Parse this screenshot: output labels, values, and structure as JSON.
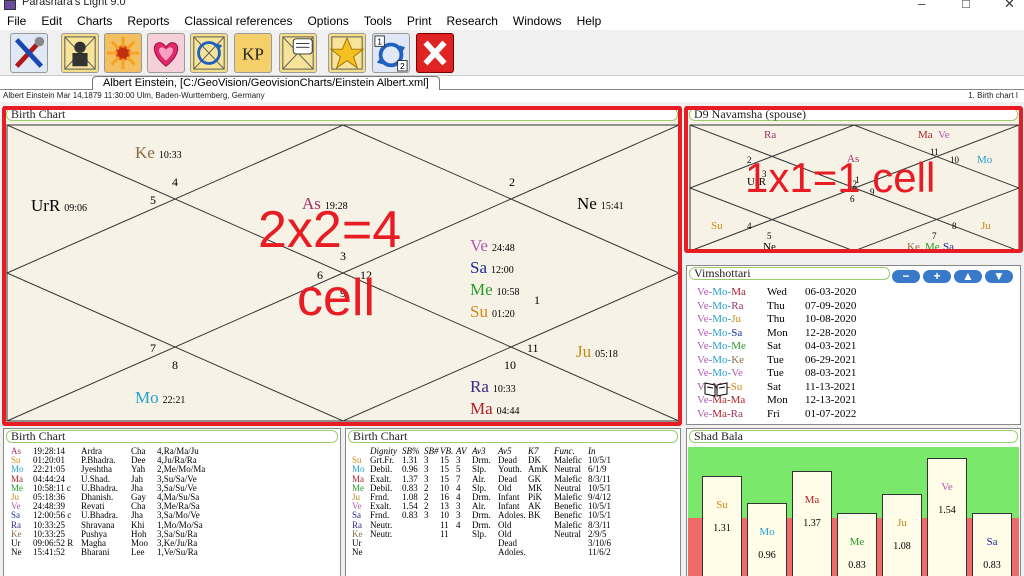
{
  "window": {
    "title": "Parashara's Light 9.0",
    "controls": [
      "–",
      "□",
      "✕"
    ]
  },
  "menu": [
    "File",
    "Edit",
    "Charts",
    "Reports",
    "Classical references",
    "Options",
    "Tools",
    "Print",
    "Research",
    "Windows",
    "Help"
  ],
  "toolbar": [
    {
      "name": "tools-icon"
    },
    {
      "name": "person-chart-icon"
    },
    {
      "name": "sun-burst-icon"
    },
    {
      "name": "hearts-icon"
    },
    {
      "name": "cycle-chart-icon"
    },
    {
      "name": "kp-icon",
      "label": "KP"
    },
    {
      "name": "notes-chart-icon"
    },
    {
      "name": "star-icon"
    },
    {
      "name": "transit-cycle-icon",
      "badges": [
        "1",
        "2"
      ]
    },
    {
      "name": "close-icon"
    }
  ],
  "tab": {
    "label": "Albert Einstein,  [C:/GeoVision/GeovisionCharts/Einstein Albert.xml]"
  },
  "status": {
    "left": "Albert Einstein  Mar 14,1879 11:30:00  Ulm, Baden-Wurttemberg, Germany",
    "right": "1. Birth chart I"
  },
  "birth_chart": {
    "title": "Birth Chart",
    "annotation_line1": "2x2=4",
    "annotation_line2": "cell",
    "house_numbers": [
      "1",
      "2",
      "3",
      "4",
      "5",
      "6",
      "7",
      "8",
      "9",
      "10",
      "11",
      "12"
    ],
    "planets": [
      {
        "name": "Ke",
        "deg": "10:33",
        "color": "#8b6b4a"
      },
      {
        "name": "UrR",
        "deg": "09:06",
        "color": "#000000"
      },
      {
        "name": "As",
        "deg": "19:28",
        "color": "#a0306a"
      },
      {
        "name": "Ne",
        "deg": "15:41",
        "color": "#000000"
      },
      {
        "name": "Ve",
        "deg": "24:48",
        "color": "#b05ab0"
      },
      {
        "name": "Sa",
        "deg": "12:00",
        "color": "#1b2a9a"
      },
      {
        "name": "Me",
        "deg": "10:58",
        "color": "#2a9a2a"
      },
      {
        "name": "Su",
        "deg": "01:20",
        "color": "#d08a1a"
      },
      {
        "name": "Ju",
        "deg": "05:18",
        "color": "#c08a1a"
      },
      {
        "name": "Mo",
        "deg": "22:21",
        "color": "#26a0d0"
      },
      {
        "name": "Ra",
        "deg": "10:33",
        "color": "#3a2a8a"
      },
      {
        "name": "Ma",
        "deg": "04:44",
        "color": "#b0202a"
      }
    ]
  },
  "navamsha": {
    "title": "D9 Navamsha  (spouse)",
    "annotation": "1x1=1 cell",
    "house_numbers": [
      "2",
      "3",
      "4",
      "5",
      "6",
      "7",
      "8",
      "9",
      "10",
      "11",
      "12",
      "1"
    ],
    "planets": [
      "Ra",
      "Ma",
      "Ve",
      "As",
      "Mo",
      "UrR",
      "Su",
      "Ju",
      "Ne",
      "Ke",
      "Me",
      "Sa"
    ]
  },
  "vimshottari": {
    "title": "Vimshottari",
    "buttons": [
      "−",
      "+",
      "▲",
      "▼"
    ],
    "rows": [
      {
        "p": "Ve-Mo-Ma",
        "d": "Wed",
        "t": "06-03-2020"
      },
      {
        "p": "Ve-Mo-Ra",
        "d": "Thu",
        "t": "07-09-2020"
      },
      {
        "p": "Ve-Mo-Ju",
        "d": "Thu",
        "t": "10-08-2020"
      },
      {
        "p": "Ve-Mo-Sa",
        "d": "Mon",
        "t": "12-28-2020"
      },
      {
        "p": "Ve-Mo-Me",
        "d": "Sat",
        "t": "04-03-2021"
      },
      {
        "p": "Ve-Mo-Ke",
        "d": "Tue",
        "t": "06-29-2021"
      },
      {
        "p": "Ve-Mo-Ve",
        "d": "Tue",
        "t": "08-03-2021"
      },
      {
        "p": "Ve-Ma-Su",
        "d": "Sat",
        "t": "11-13-2021"
      },
      {
        "p": "Ve-Ma-Ma",
        "d": "Mon",
        "t": "12-13-2021"
      },
      {
        "p": "Ve-Ma-Ra",
        "d": "Fri",
        "t": "01-07-2022"
      }
    ]
  },
  "table1": {
    "title": "Birth Chart",
    "rows": [
      [
        "As",
        "19:28:14",
        "Ardra",
        "Cha",
        "4,Ra/Ma/Ju"
      ],
      [
        "Su",
        "01:20:01",
        "P.Bhadra.",
        "Dee",
        "4,Ju/Ra/Ra"
      ],
      [
        "Mo",
        "22:21:05",
        "Jyeshtha",
        "Yah",
        "2,Me/Mo/Ma"
      ],
      [
        "Ma",
        "04:44:24",
        "U.Shad.",
        "Jah",
        "3,Su/Sa/Ve"
      ],
      [
        "Me",
        "10:58:11 c",
        "U.Bhadra.",
        "Jha",
        "3,Sa/Su/Ve"
      ],
      [
        "Ju",
        "05:18:36",
        "Dhanish.",
        "Gay",
        "4,Ma/Su/Sa"
      ],
      [
        "Ve",
        "24:48:39",
        "Revati",
        "Cha",
        "3,Me/Ra/Sa"
      ],
      [
        "Sa",
        "12:00:56 c",
        "U.Bhadra.",
        "Jha",
        "3,Sa/Mo/Ve"
      ],
      [
        "Ra",
        "10:33:25",
        "Shravana",
        "Khi",
        "1,Mo/Mo/Sa"
      ],
      [
        "Ke",
        "10:33:25",
        "Pushya",
        "Hoh",
        "3,Sa/Su/Ra"
      ],
      [
        "Ur",
        "09:06:52 R",
        "Magha",
        "Moo",
        "3,Ke/Ju/Ra"
      ],
      [
        "Ne",
        "15:41:52",
        "Bharani",
        "Lee",
        "1,Ve/Su/Ra"
      ]
    ]
  },
  "table2": {
    "title": "Birth Chart",
    "header": [
      "Dignity",
      "SB%",
      "SB#",
      "VB.",
      "AV",
      "Av3",
      "Av5",
      "K7",
      "Func.",
      "In"
    ],
    "rows": [
      [
        "Su",
        "Grt.Fr.",
        "1.31",
        "3",
        "15",
        "3",
        "Drm.",
        "Dead",
        "DK",
        "Malefic",
        "10/5/1"
      ],
      [
        "Mo",
        "Debil.",
        "0.96",
        "3",
        "15",
        "5",
        "Slp.",
        "Youth.",
        "AmK",
        "Neutral",
        "6/1/9"
      ],
      [
        "Ma",
        "Exalt.",
        "1.37",
        "3",
        "15",
        "7",
        "Alr.",
        "Dead",
        "GK",
        "Malefic",
        "8/3/11"
      ],
      [
        "Me",
        "Debil.",
        "0.83",
        "2",
        "10",
        "4",
        "Slp.",
        "Old",
        "MK",
        "Neutral",
        "10/5/1"
      ],
      [
        "Ju",
        "Frnd.",
        "1.08",
        "2",
        "16",
        "4",
        "Drm.",
        "Infant",
        "PiK",
        "Malefic",
        "9/4/12"
      ],
      [
        "Ve",
        "Exalt.",
        "1.54",
        "2",
        "13",
        "3",
        "Alr.",
        "Infant",
        "AK",
        "Benefic",
        "10/5/1"
      ],
      [
        "Sa",
        "Frnd.",
        "0.83",
        "3",
        "10",
        "3",
        "Drm.",
        "Adoles.",
        "BK",
        "Benefic",
        "10/5/1"
      ],
      [
        "Ra",
        "Neutr.",
        "",
        "",
        "11",
        "4",
        "Drm.",
        "Old",
        "",
        "Malefic",
        "8/3/11"
      ],
      [
        "Ke",
        "Neutr.",
        "",
        "",
        "11",
        "",
        "Slp.",
        "Old",
        "",
        "Neutral",
        "2/9/5"
      ],
      [
        "Ur",
        "",
        "",
        "",
        "",
        "",
        "",
        "Dead",
        "",
        "",
        "3/10/6"
      ],
      [
        "Ne",
        "",
        "",
        "",
        "",
        "",
        "",
        "Adoles.",
        "",
        "",
        "11/6/2"
      ]
    ]
  },
  "shad_bala": {
    "title": "Shad Bala",
    "bars": [
      {
        "planet": "Su",
        "value": 1.31,
        "color": "#d08a1a"
      },
      {
        "planet": "Mo",
        "value": 0.96,
        "color": "#26a0d0"
      },
      {
        "planet": "Ma",
        "value": 1.37,
        "color": "#b0202a"
      },
      {
        "planet": "Me",
        "value": 0.83,
        "color": "#2a9a2a"
      },
      {
        "planet": "Ju",
        "value": 1.08,
        "color": "#c08a1a"
      },
      {
        "planet": "Ve",
        "value": 1.54,
        "color": "#b05ab0"
      },
      {
        "planet": "Sa",
        "value": 0.83,
        "color": "#1b2a9a"
      }
    ],
    "labels": [
      "1.31",
      "0.96",
      "1.37",
      "0.83",
      "1.08",
      "1.54",
      "0.83"
    ]
  },
  "colors": {
    "accent_red": "#e81c24",
    "panel_border": "#9acd6c",
    "shad_green": "#7ae86a",
    "shad_red": "#f06a6a"
  }
}
